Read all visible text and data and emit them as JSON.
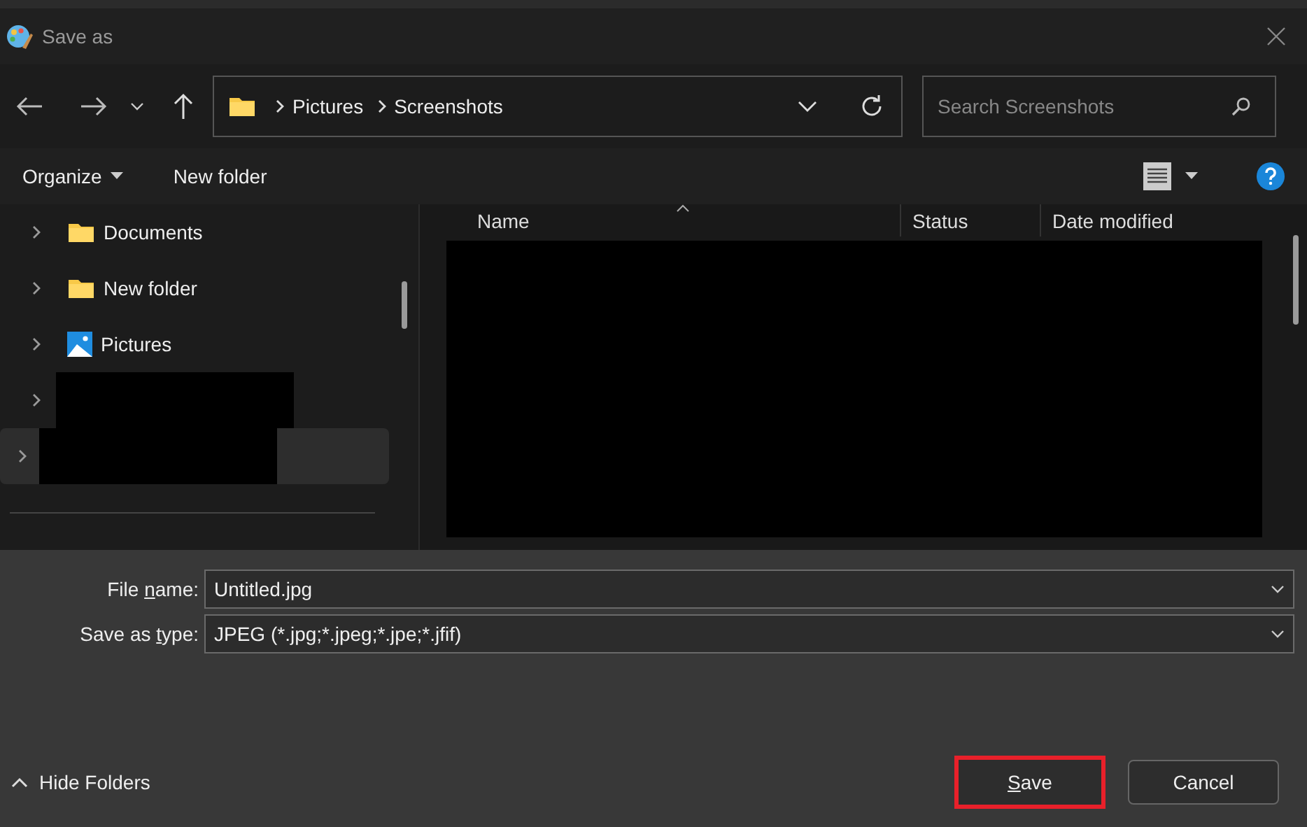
{
  "window": {
    "title": "Save as"
  },
  "address_bar": {
    "path": [
      "Pictures",
      "Screenshots"
    ]
  },
  "search": {
    "placeholder": "Search Screenshots"
  },
  "command_bar": {
    "organize": "Organize",
    "new_folder": "New folder"
  },
  "sidebar": {
    "items": [
      {
        "kind": "folder",
        "label": "Documents",
        "selected": false
      },
      {
        "kind": "folder",
        "label": "New folder",
        "selected": false
      },
      {
        "kind": "pictures",
        "label": "Pictures",
        "selected": false
      },
      {
        "kind": "redacted",
        "selected": false
      },
      {
        "kind": "redacted",
        "selected": true
      }
    ]
  },
  "file_list": {
    "columns": [
      "Name",
      "Status",
      "Date modified"
    ]
  },
  "fields": [
    {
      "label_parts": [
        {
          "text": "File ",
          "underlined": false
        },
        {
          "text": "n",
          "underlined": true
        },
        {
          "text": "ame:",
          "underlined": false
        }
      ],
      "value": "Untitled.jpg"
    },
    {
      "label_parts": [
        {
          "text": "Save as ",
          "underlined": false
        },
        {
          "text": "t",
          "underlined": true
        },
        {
          "text": "ype:",
          "underlined": false
        }
      ],
      "value": "JPEG (*.jpg;*.jpeg;*.jpe;*.jfif)"
    }
  ],
  "hide_folders": "Hide Folders",
  "buttons": [
    {
      "kind": "primary",
      "label_parts": [
        {
          "text": "S",
          "underlined": true
        },
        {
          "text": "ave",
          "underlined": false
        }
      ]
    },
    {
      "kind": "secondary",
      "label_parts": [
        {
          "text": "Cancel",
          "underlined": false
        }
      ]
    }
  ]
}
